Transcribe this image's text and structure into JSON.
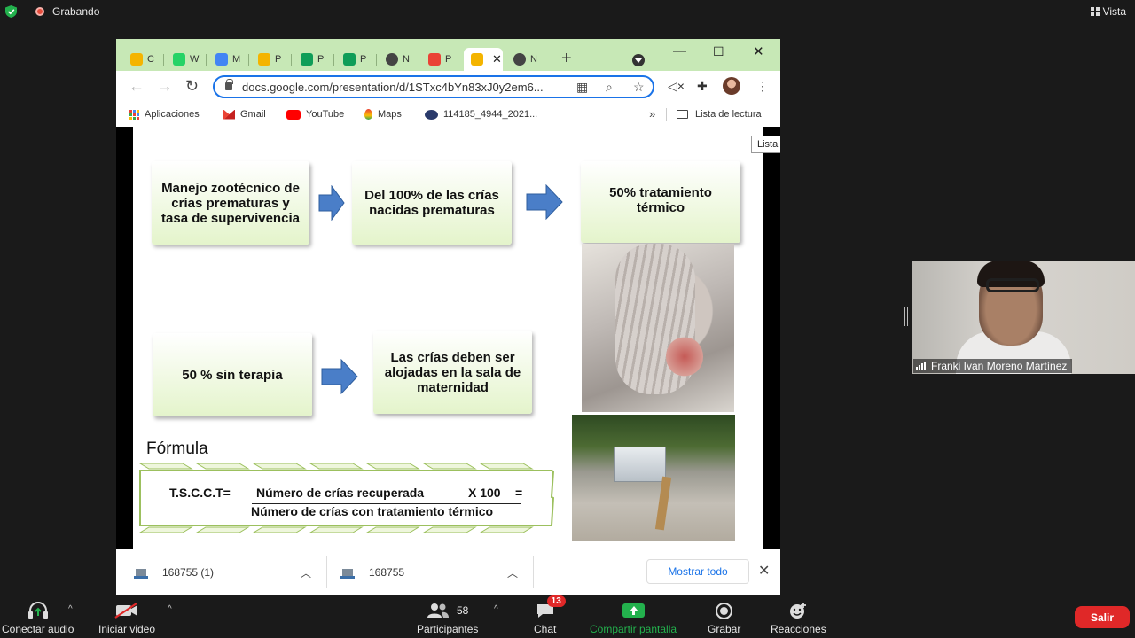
{
  "zoom": {
    "recording_label": "Grabando",
    "view_label": "Vista",
    "toolbar": {
      "audio": "Conectar audio",
      "video": "Iniciar video",
      "participants": "Participantes",
      "participants_count": "58",
      "chat": "Chat",
      "chat_badge": "13",
      "share": "Compartir pantalla",
      "record": "Grabar",
      "reactions": "Reacciones",
      "leave": "Salir"
    },
    "participant_name": "Franki Ivan Moreno Martínez"
  },
  "browser": {
    "tabs": [
      {
        "letter": "C",
        "color": "#f4b400"
      },
      {
        "letter": "W",
        "color": "#25d366"
      },
      {
        "letter": "M",
        "color": "#4285f4"
      },
      {
        "letter": "P",
        "color": "#f4b400"
      },
      {
        "letter": "P",
        "color": "#0f9d58"
      },
      {
        "letter": "P",
        "color": "#0f9d58"
      },
      {
        "letter": "N",
        "color": "#444444"
      },
      {
        "letter": "P",
        "color": "#ea4335"
      },
      {
        "letter": "",
        "color": "#f4b400"
      },
      {
        "letter": "N",
        "color": "#444444"
      }
    ],
    "new_tab": "+",
    "url": "docs.google.com/presentation/d/1STxc4bYn83xJ0y2em6...",
    "bookmarks": [
      "Aplicaciones",
      "Gmail",
      "YouTube",
      "Maps",
      "114185_4944_2021..."
    ],
    "bookmarks_more": "»",
    "reading_list": "Lista de lectura",
    "tooltip": "Lista",
    "downloads": [
      {
        "name": "168755 (1)"
      },
      {
        "name": "168755"
      }
    ],
    "show_all": "Mostrar todo"
  },
  "slide": {
    "box1": "Manejo zootécnico de crías prematuras y tasa de supervivencia",
    "box2": "Del 100% de las crías nacidas prematuras",
    "box3": "50% tratamiento térmico",
    "box4": "50 % sin terapia",
    "box5": "Las crías deben ser alojadas en la sala de maternidad",
    "formula_title": "Fórmula",
    "formula_lhs": "T.S.C.C.T=",
    "formula_numerator": "Número de crías recuperada",
    "formula_multiplier": "X 100",
    "formula_equals": "=",
    "formula_denominator": "Número de crías con tratamiento térmico"
  }
}
